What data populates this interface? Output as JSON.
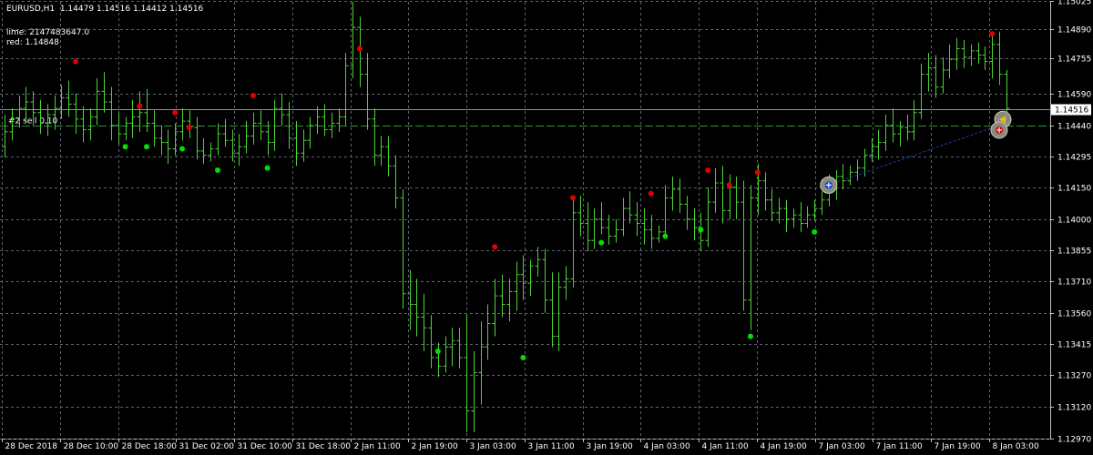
{
  "header": {
    "symbol_line": "EURUSD,H1  1.14479 1.14516 1.14412 1.14516",
    "lime_line": "lime: 2147483647.0",
    "red_line": "red: 1.14848"
  },
  "colors": {
    "background": "#000000",
    "bars": "#4cd236",
    "grid": "#5a6470",
    "up_dot": "#00e000",
    "down_dot": "#e00000",
    "price_line": "#8a94a0",
    "order_line": "#2a9a2a",
    "trade_line": "#1f3ab0",
    "axis_text": "#ffffff"
  },
  "chart_data": {
    "type": "ohlc",
    "symbol": "EURUSD",
    "timeframe": "H1",
    "ylim": [
      1.1297,
      1.1502
    ],
    "y_ticks": [
      1.15025,
      1.1489,
      1.14755,
      1.1459,
      1.1444,
      1.14295,
      1.1415,
      1.14,
      1.13855,
      1.1371,
      1.1356,
      1.13415,
      1.1327,
      1.1312,
      1.1297
    ],
    "x_ticks": [
      "28 Dec 2018",
      "28 Dec 10:00",
      "28 Dec 18:00",
      "31 Dec 02:00",
      "31 Dec 10:00",
      "31 Dec 18:00",
      "2 Jan 11:00",
      "2 Jan 19:00",
      "3 Jan 03:00",
      "3 Jan 11:00",
      "3 Jan 19:00",
      "4 Jan 03:00",
      "4 Jan 11:00",
      "4 Jan 19:00",
      "7 Jan 03:00",
      "7 Jan 11:00",
      "7 Jan 19:00",
      "8 Jan 03:00"
    ],
    "current_price_label": "1.14516",
    "current_price": 1.14516,
    "order_label": "#2 sell 0.10",
    "order_price": 1.1444,
    "bars": [
      [
        1.1434,
        1.1449,
        1.1429,
        1.1441
      ],
      [
        1.1441,
        1.1452,
        1.1437,
        1.1447
      ],
      [
        1.1447,
        1.1458,
        1.1443,
        1.1452
      ],
      [
        1.1452,
        1.1462,
        1.1446,
        1.1455
      ],
      [
        1.1455,
        1.146,
        1.1444,
        1.145
      ],
      [
        1.145,
        1.1456,
        1.144,
        1.1445
      ],
      [
        1.1445,
        1.1454,
        1.1439,
        1.1449
      ],
      [
        1.1449,
        1.1458,
        1.1442,
        1.1452
      ],
      [
        1.1452,
        1.1463,
        1.1447,
        1.1457
      ],
      [
        1.1457,
        1.1465,
        1.1448,
        1.1454
      ],
      [
        1.1454,
        1.1459,
        1.144,
        1.1447
      ],
      [
        1.1447,
        1.1453,
        1.1436,
        1.1442
      ],
      [
        1.1442,
        1.1452,
        1.1437,
        1.1448
      ],
      [
        1.1448,
        1.1466,
        1.1444,
        1.146
      ],
      [
        1.146,
        1.1469,
        1.145,
        1.1455
      ],
      [
        1.1455,
        1.1462,
        1.1437,
        1.1444
      ],
      [
        1.1444,
        1.145,
        1.1435,
        1.144
      ],
      [
        1.144,
        1.1448,
        1.1437,
        1.1445
      ],
      [
        1.1445,
        1.1456,
        1.1438,
        1.1448
      ],
      [
        1.1448,
        1.146,
        1.1441,
        1.145
      ],
      [
        1.145,
        1.1461,
        1.1441,
        1.1445
      ],
      [
        1.1445,
        1.1451,
        1.1434,
        1.1438
      ],
      [
        1.1438,
        1.1444,
        1.143,
        1.1436
      ],
      [
        1.1436,
        1.1442,
        1.1426,
        1.1433
      ],
      [
        1.1433,
        1.1445,
        1.143,
        1.1441
      ],
      [
        1.1441,
        1.1452,
        1.1437,
        1.1446
      ],
      [
        1.1446,
        1.1451,
        1.1438,
        1.1443
      ],
      [
        1.1443,
        1.1448,
        1.1428,
        1.1432
      ],
      [
        1.1432,
        1.1438,
        1.1426,
        1.143
      ],
      [
        1.143,
        1.1436,
        1.1427,
        1.1433
      ],
      [
        1.1433,
        1.1445,
        1.143,
        1.144
      ],
      [
        1.144,
        1.1447,
        1.1434,
        1.1437
      ],
      [
        1.1437,
        1.1442,
        1.1427,
        1.1431
      ],
      [
        1.1431,
        1.144,
        1.1425,
        1.1434
      ],
      [
        1.1434,
        1.1446,
        1.1431,
        1.1439
      ],
      [
        1.1439,
        1.145,
        1.1435,
        1.1445
      ],
      [
        1.1445,
        1.1451,
        1.1437,
        1.1441
      ],
      [
        1.1441,
        1.1446,
        1.143,
        1.1436
      ],
      [
        1.1436,
        1.1456,
        1.1432,
        1.1452
      ],
      [
        1.1452,
        1.1459,
        1.1444,
        1.1449
      ],
      [
        1.1449,
        1.1455,
        1.1433,
        1.1438
      ],
      [
        1.1438,
        1.1446,
        1.1425,
        1.1431
      ],
      [
        1.1431,
        1.1442,
        1.1427,
        1.1437
      ],
      [
        1.1437,
        1.1448,
        1.1433,
        1.1444
      ],
      [
        1.1444,
        1.1453,
        1.144,
        1.1448
      ],
      [
        1.1448,
        1.1454,
        1.1439,
        1.1442
      ],
      [
        1.1442,
        1.145,
        1.1438,
        1.1445
      ],
      [
        1.1445,
        1.1452,
        1.1441,
        1.1448
      ],
      [
        1.1448,
        1.1478,
        1.1444,
        1.1472
      ],
      [
        1.1472,
        1.1502,
        1.1466,
        1.149
      ],
      [
        1.149,
        1.1495,
        1.1462,
        1.1468
      ],
      [
        1.1468,
        1.1478,
        1.1442,
        1.1447
      ],
      [
        1.1447,
        1.1452,
        1.1425,
        1.143
      ],
      [
        1.143,
        1.1439,
        1.1425,
        1.1434
      ],
      [
        1.1434,
        1.1439,
        1.142,
        1.1425
      ],
      [
        1.1425,
        1.143,
        1.1405,
        1.141
      ],
      [
        1.141,
        1.1414,
        1.1358,
        1.1365
      ],
      [
        1.1365,
        1.1376,
        1.1348,
        1.136
      ],
      [
        1.136,
        1.1372,
        1.1345,
        1.1354
      ],
      [
        1.1354,
        1.1365,
        1.1338,
        1.1349
      ],
      [
        1.1349,
        1.1355,
        1.133,
        1.1335
      ],
      [
        1.1335,
        1.1342,
        1.1326,
        1.1331
      ],
      [
        1.1331,
        1.1345,
        1.1328,
        1.134
      ],
      [
        1.134,
        1.1349,
        1.1331,
        1.1343
      ],
      [
        1.1343,
        1.1349,
        1.133,
        1.1335
      ],
      [
        1.1335,
        1.1355,
        1.13,
        1.131
      ],
      [
        1.131,
        1.1338,
        1.13,
        1.1328
      ],
      [
        1.1328,
        1.1352,
        1.1313,
        1.134
      ],
      [
        1.134,
        1.136,
        1.1334,
        1.1351
      ],
      [
        1.1351,
        1.1372,
        1.1345,
        1.1364
      ],
      [
        1.1364,
        1.1374,
        1.1354,
        1.136
      ],
      [
        1.136,
        1.1372,
        1.1352,
        1.1366
      ],
      [
        1.1366,
        1.138,
        1.1357,
        1.1374
      ],
      [
        1.1374,
        1.1383,
        1.1362,
        1.137
      ],
      [
        1.137,
        1.1381,
        1.1364,
        1.1378
      ],
      [
        1.1378,
        1.1387,
        1.1373,
        1.1381
      ],
      [
        1.1381,
        1.1386,
        1.1356,
        1.1362
      ],
      [
        1.1362,
        1.1375,
        1.134,
        1.1345
      ],
      [
        1.1345,
        1.1375,
        1.1338,
        1.1368
      ],
      [
        1.1368,
        1.1378,
        1.1362,
        1.1372
      ],
      [
        1.1372,
        1.141,
        1.1368,
        1.1403
      ],
      [
        1.1403,
        1.1411,
        1.1392,
        1.1398
      ],
      [
        1.1398,
        1.1408,
        1.1385,
        1.139
      ],
      [
        1.139,
        1.1405,
        1.1386,
        1.14
      ],
      [
        1.14,
        1.1408,
        1.1393,
        1.1396
      ],
      [
        1.1396,
        1.1402,
        1.1388,
        1.1392
      ],
      [
        1.1392,
        1.14,
        1.1389,
        1.1395
      ],
      [
        1.1395,
        1.141,
        1.1392,
        1.1405
      ],
      [
        1.1405,
        1.1413,
        1.1398,
        1.1402
      ],
      [
        1.1402,
        1.1408,
        1.1392,
        1.1398
      ],
      [
        1.1398,
        1.1405,
        1.1388,
        1.1395
      ],
      [
        1.1395,
        1.1402,
        1.1386,
        1.1391
      ],
      [
        1.1391,
        1.1397,
        1.1389,
        1.1394
      ],
      [
        1.1394,
        1.1416,
        1.1391,
        1.141
      ],
      [
        1.141,
        1.142,
        1.1404,
        1.1414
      ],
      [
        1.1414,
        1.1419,
        1.1403,
        1.1407
      ],
      [
        1.1407,
        1.1411,
        1.1395,
        1.14
      ],
      [
        1.14,
        1.1405,
        1.139,
        1.1396
      ],
      [
        1.1396,
        1.1403,
        1.1385,
        1.139
      ],
      [
        1.139,
        1.1415,
        1.1387,
        1.1408
      ],
      [
        1.1408,
        1.1424,
        1.1403,
        1.1417
      ],
      [
        1.1417,
        1.1425,
        1.1398,
        1.1404
      ],
      [
        1.1404,
        1.1421,
        1.14,
        1.1415
      ],
      [
        1.1415,
        1.142,
        1.14,
        1.1408
      ],
      [
        1.1408,
        1.1418,
        1.1357,
        1.1362
      ],
      [
        1.1362,
        1.1416,
        1.1348,
        1.141
      ],
      [
        1.141,
        1.1426,
        1.1402,
        1.1418
      ],
      [
        1.1418,
        1.1422,
        1.1404,
        1.1409
      ],
      [
        1.1409,
        1.1414,
        1.1399,
        1.1403
      ],
      [
        1.1403,
        1.141,
        1.1398,
        1.1405
      ],
      [
        1.1405,
        1.1409,
        1.1394,
        1.14
      ],
      [
        1.14,
        1.1405,
        1.1396,
        1.1402
      ],
      [
        1.1402,
        1.1408,
        1.1394,
        1.1398
      ],
      [
        1.1398,
        1.1406,
        1.1396,
        1.1402
      ],
      [
        1.1402,
        1.1409,
        1.1399,
        1.1405
      ],
      [
        1.1405,
        1.1413,
        1.1402,
        1.1409
      ],
      [
        1.1409,
        1.1421,
        1.1406,
        1.1416
      ],
      [
        1.1416,
        1.1423,
        1.1409,
        1.142
      ],
      [
        1.142,
        1.1426,
        1.1414,
        1.1418
      ],
      [
        1.1418,
        1.1425,
        1.1416,
        1.1422
      ],
      [
        1.1422,
        1.1428,
        1.1418,
        1.1424
      ],
      [
        1.1424,
        1.1433,
        1.142,
        1.143
      ],
      [
        1.143,
        1.1438,
        1.1427,
        1.1434
      ],
      [
        1.1434,
        1.1442,
        1.1428,
        1.1436
      ],
      [
        1.1436,
        1.1449,
        1.1432,
        1.1444
      ],
      [
        1.1444,
        1.1452,
        1.1436,
        1.144
      ],
      [
        1.144,
        1.1446,
        1.1434,
        1.1443
      ],
      [
        1.1443,
        1.1449,
        1.1437,
        1.1441
      ],
      [
        1.1441,
        1.1456,
        1.1437,
        1.145
      ],
      [
        1.145,
        1.1473,
        1.1447,
        1.1468
      ],
      [
        1.1468,
        1.1478,
        1.146,
        1.1471
      ],
      [
        1.1471,
        1.1477,
        1.1457,
        1.1462
      ],
      [
        1.1462,
        1.1476,
        1.1459,
        1.147
      ],
      [
        1.147,
        1.1482,
        1.1466,
        1.1475
      ],
      [
        1.1475,
        1.1485,
        1.147,
        1.148
      ],
      [
        1.148,
        1.1484,
        1.1471,
        1.1476
      ],
      [
        1.1476,
        1.1482,
        1.1472,
        1.1479
      ],
      [
        1.1479,
        1.1483,
        1.1473,
        1.1477
      ],
      [
        1.1477,
        1.1481,
        1.147,
        1.1474
      ],
      [
        1.1474,
        1.1486,
        1.1466,
        1.1482
      ],
      [
        1.1482,
        1.1488,
        1.1463,
        1.1468
      ],
      [
        1.1468,
        1.147,
        1.1441,
        1.1452
      ]
    ],
    "red_dots": [
      [
        10,
        1.1474
      ],
      [
        19,
        1.1453
      ],
      [
        24,
        1.145
      ],
      [
        26,
        1.1443
      ],
      [
        35,
        1.1458
      ],
      [
        50,
        1.148
      ],
      [
        69,
        1.1387
      ],
      [
        80,
        1.141
      ],
      [
        91,
        1.1412
      ],
      [
        99,
        1.1423
      ],
      [
        102,
        1.1416
      ],
      [
        106,
        1.1422
      ],
      [
        139,
        1.1487
      ]
    ],
    "green_dots": [
      [
        17,
        1.1434
      ],
      [
        20,
        1.1434
      ],
      [
        25,
        1.1433
      ],
      [
        30,
        1.1423
      ],
      [
        37,
        1.1424
      ],
      [
        61,
        1.1338
      ],
      [
        73,
        1.1335
      ],
      [
        84,
        1.1389
      ],
      [
        93,
        1.1392
      ],
      [
        98,
        1.1395
      ],
      [
        105,
        1.1345
      ],
      [
        114,
        1.1394
      ]
    ],
    "trade_open": {
      "bar": 116,
      "price": 1.1416
    },
    "trade_close": {
      "bar": 140,
      "price": 1.1444
    }
  }
}
